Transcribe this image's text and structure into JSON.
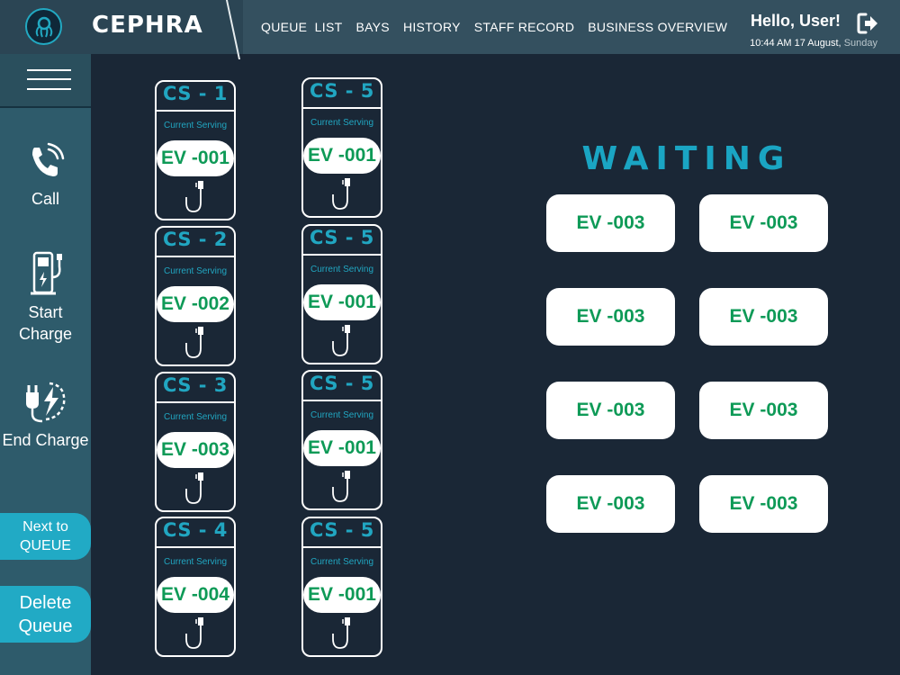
{
  "app": {
    "brand": "CEPHRA"
  },
  "nav": [
    {
      "label": "QUEUE  LIST"
    },
    {
      "label": "BAYS"
    },
    {
      "label": "HISTORY"
    },
    {
      "label": "STAFF RECORD"
    },
    {
      "label": "BUSINESS OVERVIEW"
    }
  ],
  "user": {
    "greeting": "Hello, User!",
    "time_date": "10:44 AM 17 August,",
    "day": "Sunday"
  },
  "sidebar": {
    "call_label": "Call",
    "start_charge_label": "Start Charge",
    "end_charge_label": "End Charge",
    "next_queue_label": "Next to QUEUE",
    "delete_queue_label": "Delete Queue"
  },
  "stations": [
    {
      "name": "CS - 1",
      "status": "Current Serving",
      "ticket": "EV -001"
    },
    {
      "name": "CS - 2",
      "status": "Current Serving",
      "ticket": "EV -002"
    },
    {
      "name": "CS - 3",
      "status": "Current Serving",
      "ticket": "EV -003"
    },
    {
      "name": "CS - 4",
      "status": "Current Serving",
      "ticket": "EV -004"
    },
    {
      "name": "CS - 5",
      "status": "Current Serving",
      "ticket": "EV -001"
    },
    {
      "name": "CS - 5",
      "status": "Current Serving",
      "ticket": "EV -001"
    },
    {
      "name": "CS - 5",
      "status": "Current Serving",
      "ticket": "EV -001"
    },
    {
      "name": "CS - 5",
      "status": "Current Serving",
      "ticket": "EV -001"
    }
  ],
  "waiting": {
    "title": "WAITING",
    "tickets": [
      "EV -003",
      "EV -003",
      "EV -003",
      "EV -003",
      "EV -003",
      "EV -003",
      "EV -003",
      "EV -003"
    ]
  },
  "colors": {
    "background": "#1a2736",
    "header": "#34505f",
    "sidebar": "#2e5b6b",
    "accent": "#21a6c1",
    "ticket_text": "#0e9a57"
  },
  "icons": {
    "logo": "octopus-logo-icon",
    "logout": "logout-icon",
    "menu": "hamburger-menu-icon",
    "call": "phone-ringing-icon",
    "start_charge": "charging-station-icon",
    "end_charge": "unplug-charge-icon",
    "plug": "plug-cable-icon"
  }
}
